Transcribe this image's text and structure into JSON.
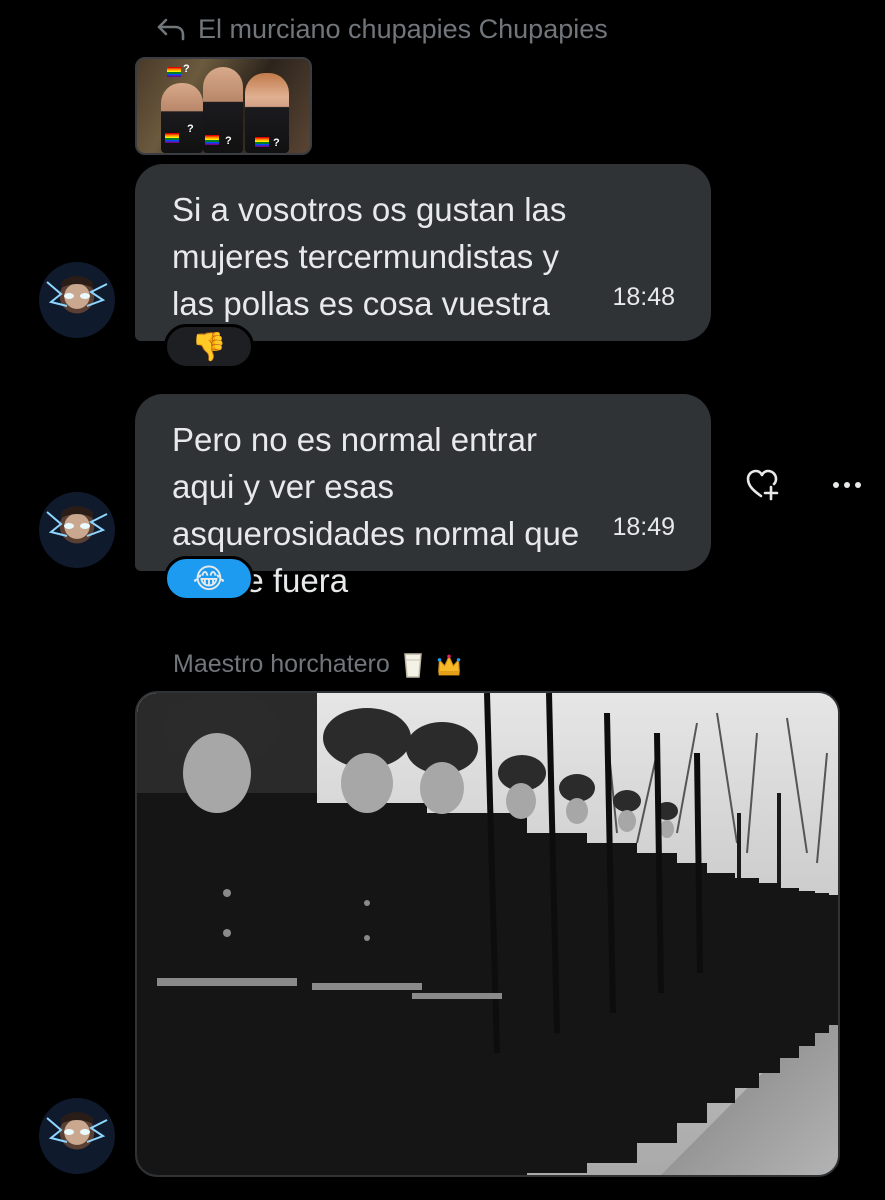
{
  "reply": {
    "icon": "reply-arrow-icon",
    "label": "El murciano chupapies Chupapies",
    "thumbnail_marks": [
      "?",
      "?",
      "?",
      "?"
    ]
  },
  "messages": [
    {
      "text": "Si a vosotros os gustan las mujeres tercermundistas y las pollas es cosa vuestra",
      "time": "18:48",
      "reaction": "👎"
    },
    {
      "text": "Pero no es normal entrar aqui y ver esas asquerosidades normal que lyly se fuera",
      "time": "18:49",
      "reaction": "😂"
    }
  ],
  "actions": {
    "react_icon": "heart-add-icon",
    "more_icon": "more-horizontal-icon"
  },
  "media_message": {
    "sender": "Maestro horchatero",
    "sender_emojis": [
      "glass-of-milk-icon",
      "crown-icon"
    ]
  },
  "colors": {
    "background": "#000000",
    "bubble": "#2f3336",
    "muted_text": "#71767b",
    "reaction_active": "#1d9bf0"
  }
}
